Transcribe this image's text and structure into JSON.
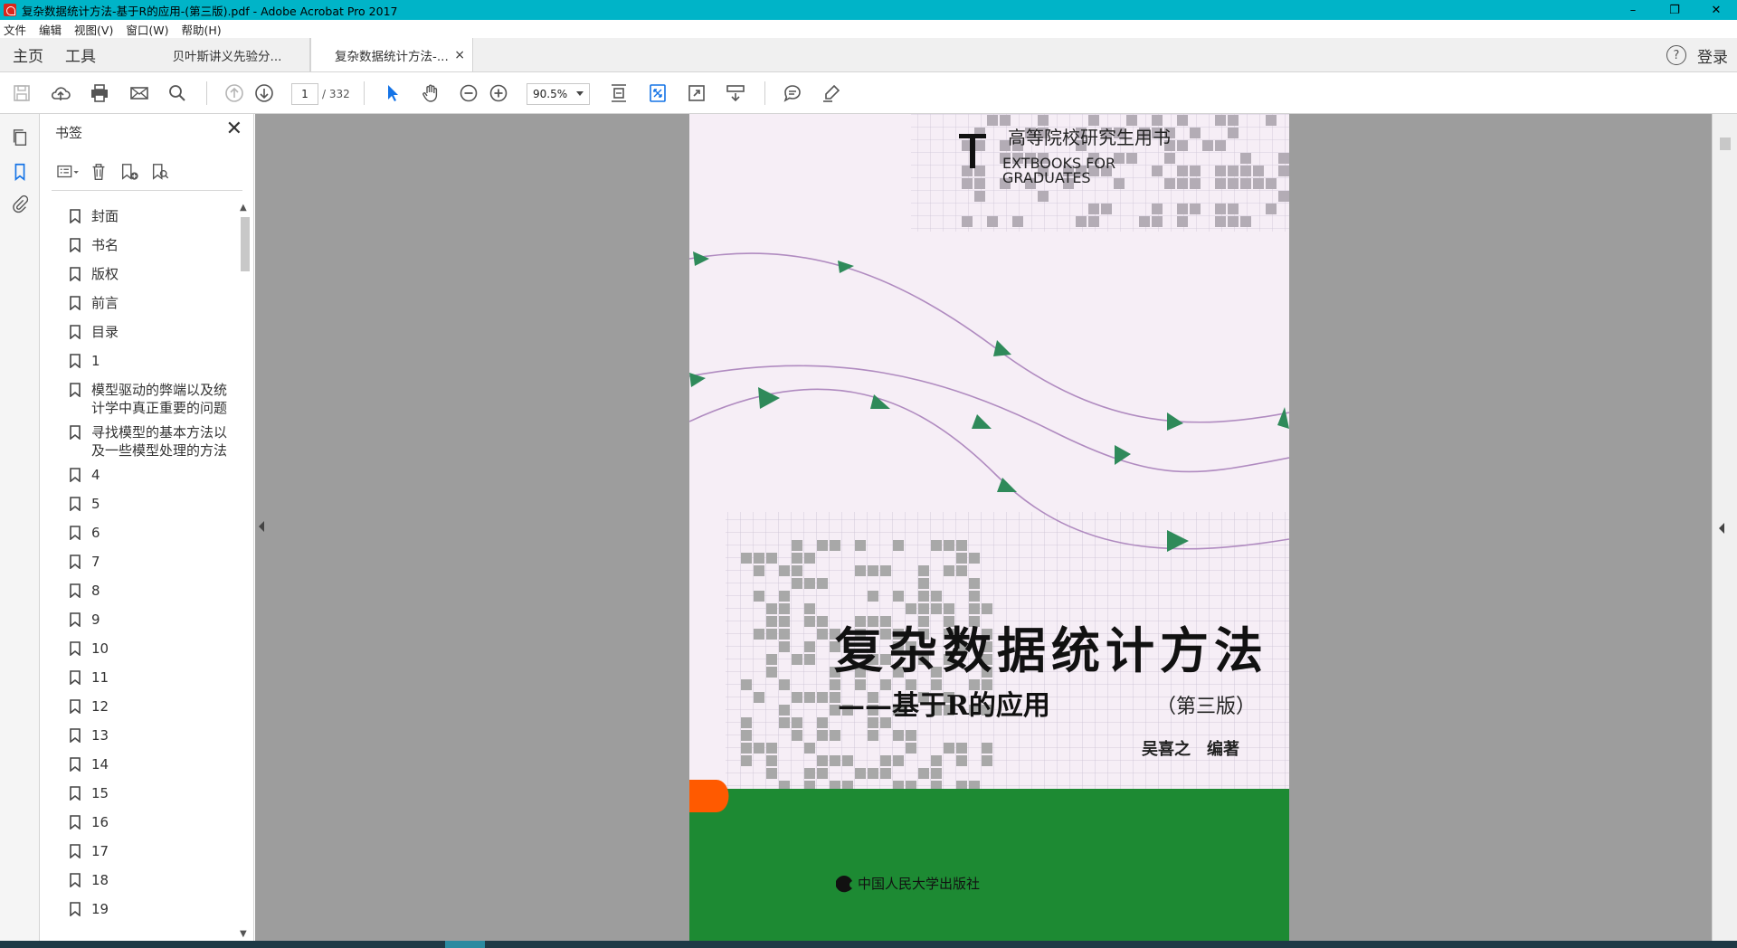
{
  "titlebar": {
    "title": "复杂数据统计方法-基于R的应用-(第三版).pdf - Adobe Acrobat Pro 2017",
    "controls": [
      "–",
      "❐",
      "✕"
    ]
  },
  "menu": {
    "items": [
      "文件",
      "编辑",
      "视图(V)",
      "窗口(W)",
      "帮助(H)"
    ]
  },
  "tabs": {
    "home": "主页",
    "tools": "工具",
    "doc1": "贝叶斯讲义先验分...",
    "doc2": "复杂数据统计方法-...",
    "close": "×",
    "help": "?",
    "login": "登录"
  },
  "toolbar": {
    "page_current": "1",
    "page_total": "/ 332",
    "zoom": "90.5%"
  },
  "bookmarks": {
    "title": "书签",
    "close": "✕",
    "items": [
      "封面",
      "书名",
      "版权",
      "前言",
      "目录",
      "1",
      "模型驱动的弊端以及统计学中真正重要的问题",
      "寻找模型的基本方法以及一些模型处理的方法",
      "4",
      "5",
      "6",
      "7",
      "8",
      "9",
      "10",
      "11",
      "12",
      "13",
      "14",
      "15",
      "16",
      "17",
      "18",
      "19"
    ]
  },
  "cover": {
    "series_cn": "高等院校研究生用书",
    "series_en_1": "EXTBOOKS FOR",
    "series_en_2": "GRADUATES",
    "title": "复杂数据统计方法",
    "subtitle": "——基于R的应用",
    "edition": "（第三版）",
    "author": "吴喜之　编著",
    "publisher": "中国人民大学出版社"
  },
  "colors": {
    "titlebar": "#00b4c8",
    "accent_blue": "#1473e6",
    "cover_green": "#1d8a33",
    "cover_bg": "#f6eef6",
    "arrow_green": "#2f8a5a",
    "orange": "#ff5a00"
  }
}
